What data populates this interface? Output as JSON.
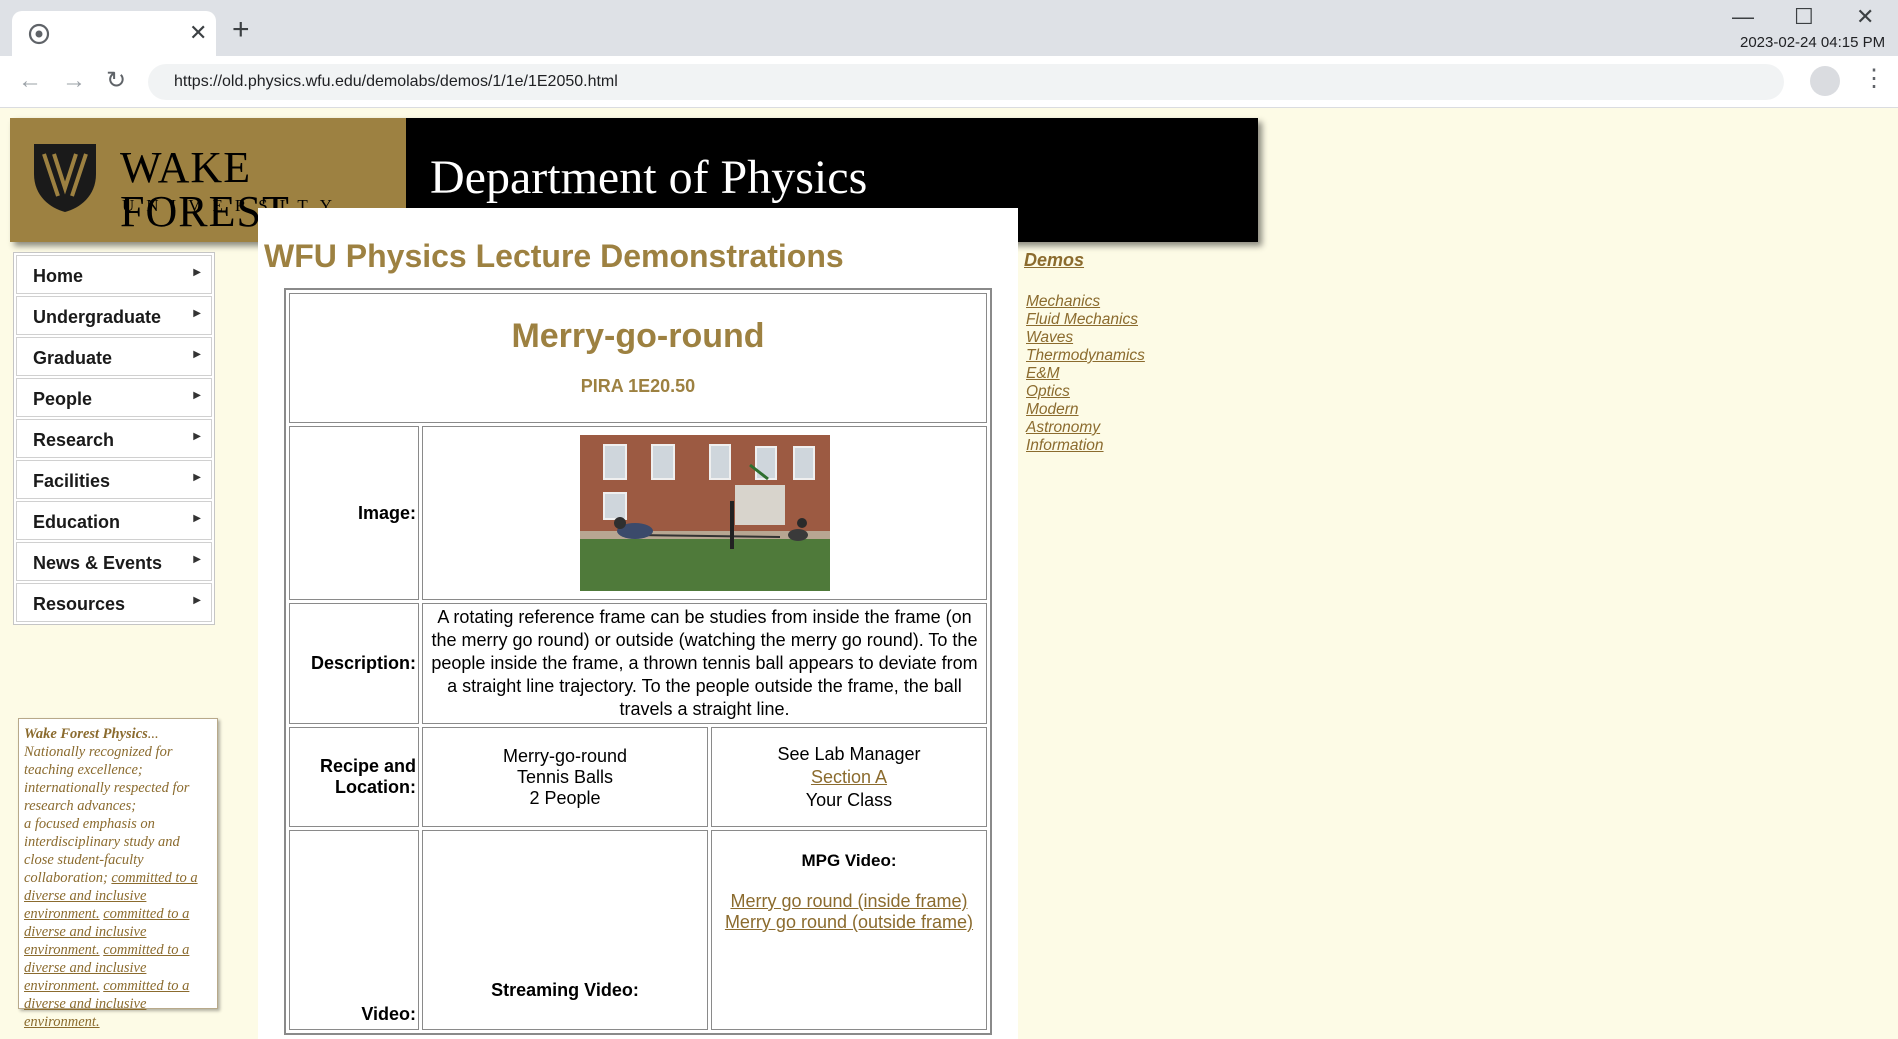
{
  "browser": {
    "tab_close": "✕",
    "new_tab": "+",
    "url": "https://old.physics.wfu.edu/demolabs/demos/1/1e/1E2050.html",
    "clock": "2023-02-24 04:15 PM",
    "window_buttons": {
      "minimize": "—",
      "maximize": "☐",
      "close": "✕"
    },
    "icons": [
      "back-arrow-icon",
      "forward-arrow-icon",
      "reload-icon",
      "bookmark-star-icon",
      "profile-icon",
      "kebab-menu-icon"
    ]
  },
  "banner": {
    "university_name": "WAKE FOREST",
    "university_sub": "UNIVERSITY",
    "department": "Department of Physics"
  },
  "sidenav": {
    "items": [
      {
        "label": "Home"
      },
      {
        "label": "Undergraduate"
      },
      {
        "label": "Graduate"
      },
      {
        "label": "People"
      },
      {
        "label": "Research"
      },
      {
        "label": "Facilities"
      },
      {
        "label": "Education"
      },
      {
        "label": "News & Events"
      },
      {
        "label": "Resources"
      }
    ]
  },
  "quote": {
    "title": "Wake Forest Physics",
    "ellipsis": "...",
    "lines": [
      "Nationally recognized for teaching excellence;",
      "internationally respected for research advances;",
      "a focused emphasis on interdisciplinary study and close student-faculty collaboration;"
    ],
    "link_text": "committed to a diverse and inclusive environment."
  },
  "main": {
    "page_title": "WFU Physics Lecture Demonstrations",
    "demo": {
      "name": "Merry-go-round",
      "pira": "PIRA 1E20.50",
      "image_label": "Image:",
      "description_label": "Description:",
      "description": "A rotating reference frame can be studies from inside the frame (on the merry go round) or outside (watching the merry go round). To the people inside the frame, a thrown tennis ball appears to deviate from a straight line trajectory. To the people outside the frame, the ball travels a straight line.",
      "recipe_label": "Recipe and Location:",
      "recipe": [
        "Merry-go-round",
        "Tennis Balls",
        "2 People"
      ],
      "location": {
        "line1": "See Lab Manager",
        "link": "Section A",
        "line3": "Your Class"
      },
      "video_label": "Video:",
      "streaming_label": "Streaming Video:",
      "mpg_label": "MPG Video:",
      "mpg_links": [
        "Merry go round (inside frame)",
        "Merry go round (outside frame)"
      ]
    }
  },
  "rightbar": {
    "heading": "Demos",
    "links": [
      "Mechanics",
      "Fluid Mechanics",
      "Waves",
      "Thermodynamics",
      "E&M",
      "Optics",
      "Modern",
      "Astronomy",
      "Information"
    ]
  },
  "colors": {
    "brand_gold": "#9d8141",
    "link_brown": "#8b6b2e",
    "page_bg": "#fdfbe6"
  }
}
